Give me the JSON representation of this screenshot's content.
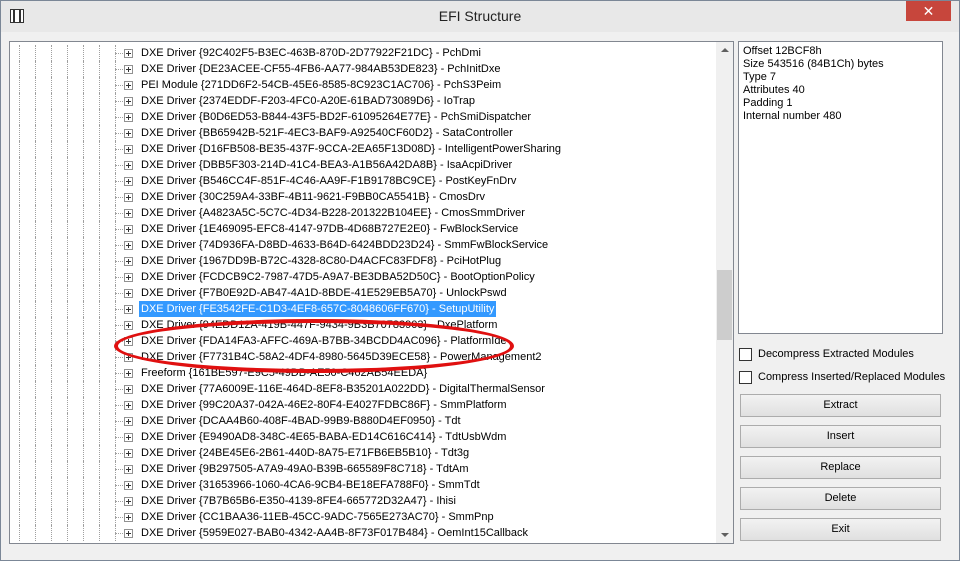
{
  "window": {
    "title": "EFI Structure",
    "close_label": "✕"
  },
  "tree": {
    "selected_index": 17,
    "items": [
      {
        "text": "DXE Driver {92C402F5-B3EC-463B-870D-2D77922F21DC} - PchDmi"
      },
      {
        "text": "DXE Driver {DE23ACEE-CF55-4FB6-AA77-984AB53DE823} - PchInitDxe"
      },
      {
        "text": "PEI Module {271DD6F2-54CB-45E6-8585-8C923C1AC706} - PchS3Peim"
      },
      {
        "text": "DXE Driver {2374EDDF-F203-4FC0-A20E-61BAD73089D6} - IoTrap"
      },
      {
        "text": "DXE Driver {B0D6ED53-B844-43F5-BD2F-61095264E77E} - PchSmiDispatcher"
      },
      {
        "text": "DXE Driver {BB65942B-521F-4EC3-BAF9-A92540CF60D2} - SataController"
      },
      {
        "text": "DXE Driver {D16FB508-BE35-437F-9CCA-2EA65F13D08D} - IntelligentPowerSharing"
      },
      {
        "text": "DXE Driver {DBB5F303-214D-41C4-BEA3-A1B56A42DA8B} - IsaAcpiDriver"
      },
      {
        "text": "DXE Driver {B546CC4F-851F-4C46-AA9F-F1B9178BC9CE} - PostKeyFnDrv"
      },
      {
        "text": "DXE Driver {30C259A4-33BF-4B11-9621-F9BB0CA5541B} - CmosDrv"
      },
      {
        "text": "DXE Driver {A4823A5C-5C7C-4D34-B228-201322B104EE} - CmosSmmDriver"
      },
      {
        "text": "DXE Driver {1E469095-EFC8-4147-97DB-4D68B727E2E0} - FwBlockService"
      },
      {
        "text": "DXE Driver {74D936FA-D8BD-4633-B64D-6424BDD23D24} - SmmFwBlockService"
      },
      {
        "text": "DXE Driver {1967DD9B-B72C-4328-8C80-D4ACFC83FDF8} - PciHotPlug"
      },
      {
        "text": "DXE Driver {FCDCB9C2-7987-47D5-A9A7-BE3DBA52D50C} - BootOptionPolicy"
      },
      {
        "text": "DXE Driver {F7B0E92D-AB47-4A1D-8BDE-41E529EB5A70} - UnlockPswd"
      },
      {
        "text": "DXE Driver {FE3542FE-C1D3-4EF8-657C-8048606FF670} - SetupUtility"
      },
      {
        "text": "DXE Driver {94EDD12A-419B-447F-9434-9B3B70783903} - DxePlatform"
      },
      {
        "text": "DXE Driver {FDA14FA3-AFFC-469A-B7BB-34BCDD4AC096} - PlatformIde"
      },
      {
        "text": "DXE Driver {F7731B4C-58A2-4DF4-8980-5645D39ECE58} - PowerManagement2"
      },
      {
        "text": "Freeform {161BE597-E9C5-49DB-AE50-C462AB54EEDA}"
      },
      {
        "text": "DXE Driver {77A6009E-116E-464D-8EF8-B35201A022DD} - DigitalThermalSensor"
      },
      {
        "text": "DXE Driver {99C20A37-042A-46E2-80F4-E4027FDBC86F} - SmmPlatform"
      },
      {
        "text": "DXE Driver {DCAA4B60-408F-4BAD-99B9-B880D4EF0950} - Tdt"
      },
      {
        "text": "DXE Driver {E9490AD8-348C-4E65-BABA-ED14C616C414} - TdtUsbWdm"
      },
      {
        "text": "DXE Driver {24BE45E6-2B61-440D-8A75-E71FB6EB5B10} - Tdt3g"
      },
      {
        "text": "DXE Driver {9B297505-A7A9-49A0-B39B-665589F8C718} - TdtAm"
      },
      {
        "text": "DXE Driver {31653966-1060-4CA6-9CB4-BE18EFA788F0} - SmmTdt"
      },
      {
        "text": "DXE Driver {7B7B65B6-E350-4139-8FE4-665772D32A47} - Ihisi"
      },
      {
        "text": "DXE Driver {CC1BAA36-11EB-45CC-9ADC-7565E273AC70} - SmmPnp"
      },
      {
        "text": "DXE Driver {5959E027-BAB0-4342-AA4B-8F73F017B484} - OemInt15Callback"
      }
    ]
  },
  "info": {
    "lines": [
      "Offset 12BCF8h",
      "Size 543516 (84B1Ch) bytes",
      "Type 7",
      "Attributes 40",
      "Padding 1",
      "Internal number 480"
    ]
  },
  "options": {
    "decompress_label": "Decompress Extracted Modules",
    "compress_label": "Compress Inserted/Replaced Modules"
  },
  "buttons": {
    "extract": "Extract",
    "insert": "Insert",
    "replace": "Replace",
    "delete": "Delete",
    "exit": "Exit"
  },
  "colors": {
    "selection": "#3399ff",
    "annotation": "#e01010",
    "close_button": "#c7463c"
  }
}
